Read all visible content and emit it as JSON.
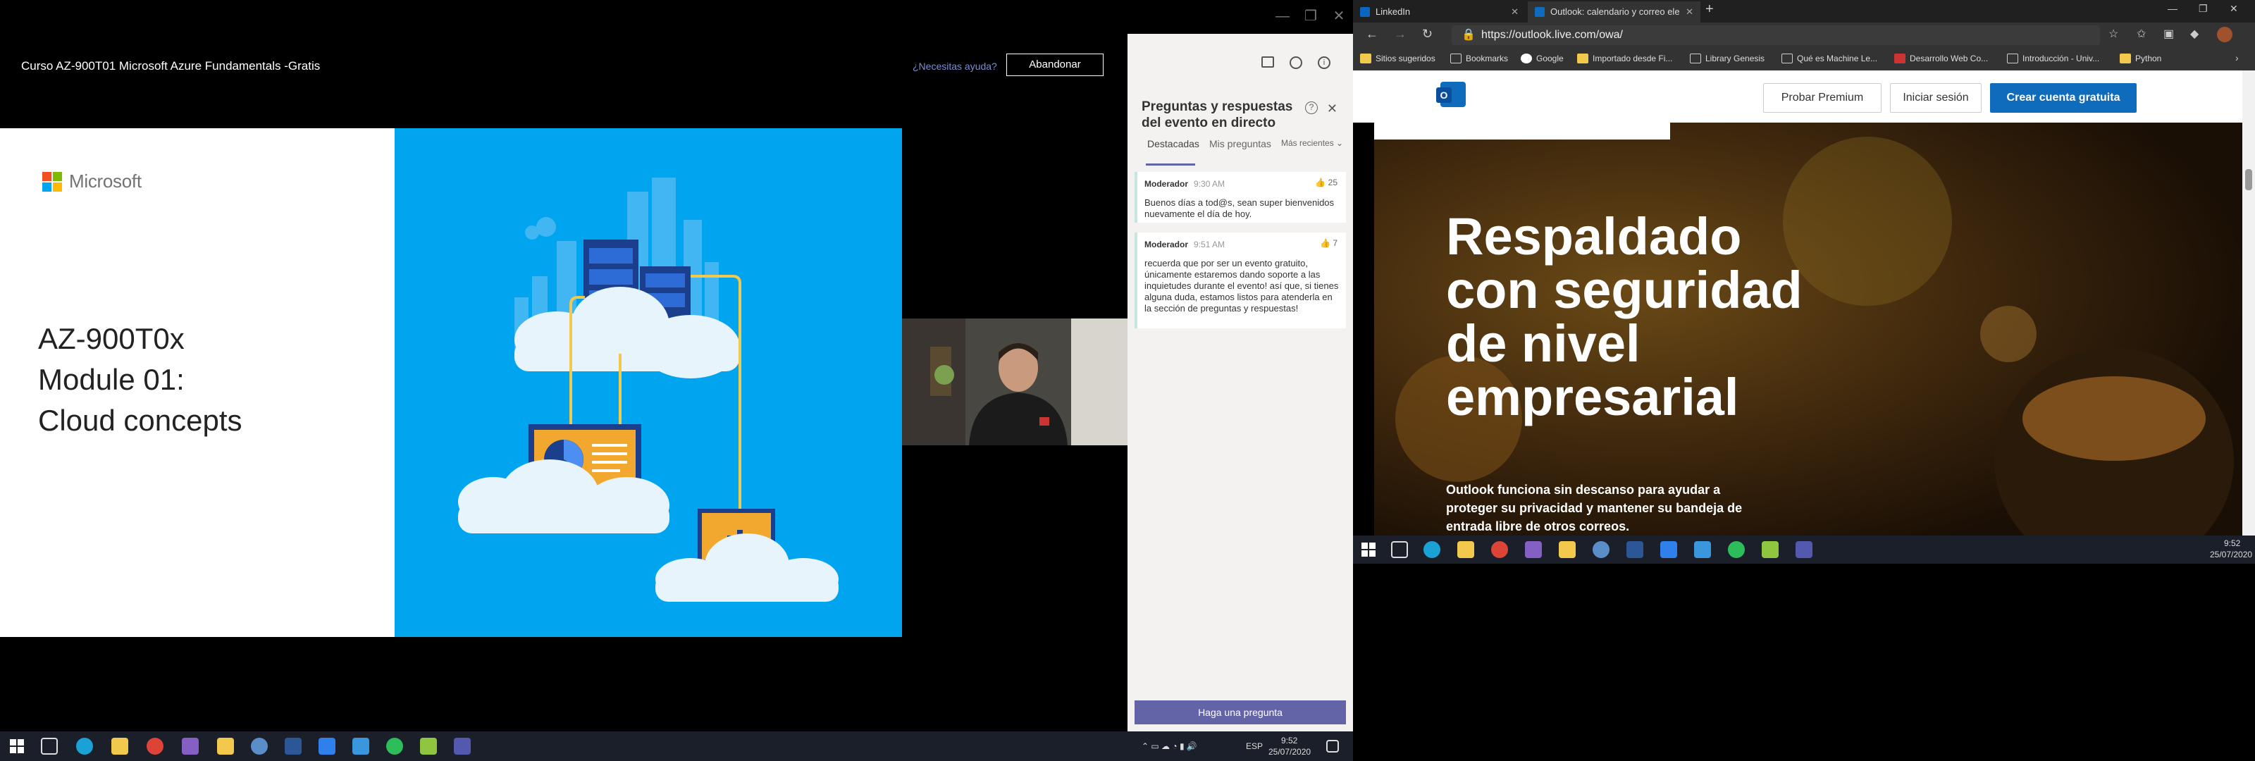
{
  "left": {
    "window_controls": [
      "—",
      "❐",
      "✕"
    ],
    "event": {
      "title": "Curso AZ-900T01 Microsoft Azure Fundamentals -Gratis",
      "help": "¿Necesitas ayuda?",
      "leave_button": "Abandonar"
    },
    "slide": {
      "brand": "Microsoft",
      "line1": "AZ-900T0x",
      "line2": "Module 01:",
      "line3": "Cloud concepts"
    },
    "qa": {
      "title": "Preguntas y respuestas del evento en directo",
      "tabs": [
        "Destacadas",
        "Mis preguntas",
        "Más recientes ⌄"
      ],
      "cards": [
        {
          "author": "Moderador",
          "time": "9:30 AM",
          "likes": "25",
          "body": "Buenos días a tod@s, sean super bienvenidos nuevamente el día de hoy."
        },
        {
          "author": "Moderador",
          "time": "9:51 AM",
          "likes": "7",
          "body": "recuerda que por ser un evento gratuito, únicamente estaremos dando soporte a las inquietudes durante el evento! así que, si tienes alguna duda, estamos listos para atenderla en la sección de preguntas y respuestas!"
        }
      ],
      "ask_button": "Haga una pregunta"
    },
    "tray": {
      "lang": "ESP",
      "time": "9:52",
      "date": "25/07/2020"
    }
  },
  "right": {
    "tabs": [
      {
        "label": "LinkedIn",
        "active": false
      },
      {
        "label": "Outlook: calendario y correo ele",
        "active": true
      }
    ],
    "new_tab": "+",
    "window_controls": [
      "—",
      "❐",
      "✕"
    ],
    "url": "https://outlook.live.com/owa/",
    "bookmarks": [
      "Sitios sugeridos",
      "Bookmarks",
      "Google",
      "Importado desde Fi...",
      "Library Genesis",
      "Qué es Machine Le...",
      "Desarrollo Web Co...",
      "Introducción - Univ...",
      "Python"
    ],
    "outlook": {
      "premium_button": "Probar Premium",
      "signin_button": "Iniciar sesión",
      "create_button": "Crear cuenta gratuita",
      "hero_title": "Respaldado con seguridad de nivel empresarial",
      "hero_sub": "Outlook funciona sin descanso para ayudar a proteger su privacidad y mantener su bandeja de entrada libre de otros correos."
    },
    "tray": {
      "time": "9:52",
      "date": "25/07/2020"
    }
  },
  "colors": {
    "teams_purple": "#6264a7",
    "outlook_blue": "#0f6cbd",
    "azure_blue": "#00a4ef"
  }
}
